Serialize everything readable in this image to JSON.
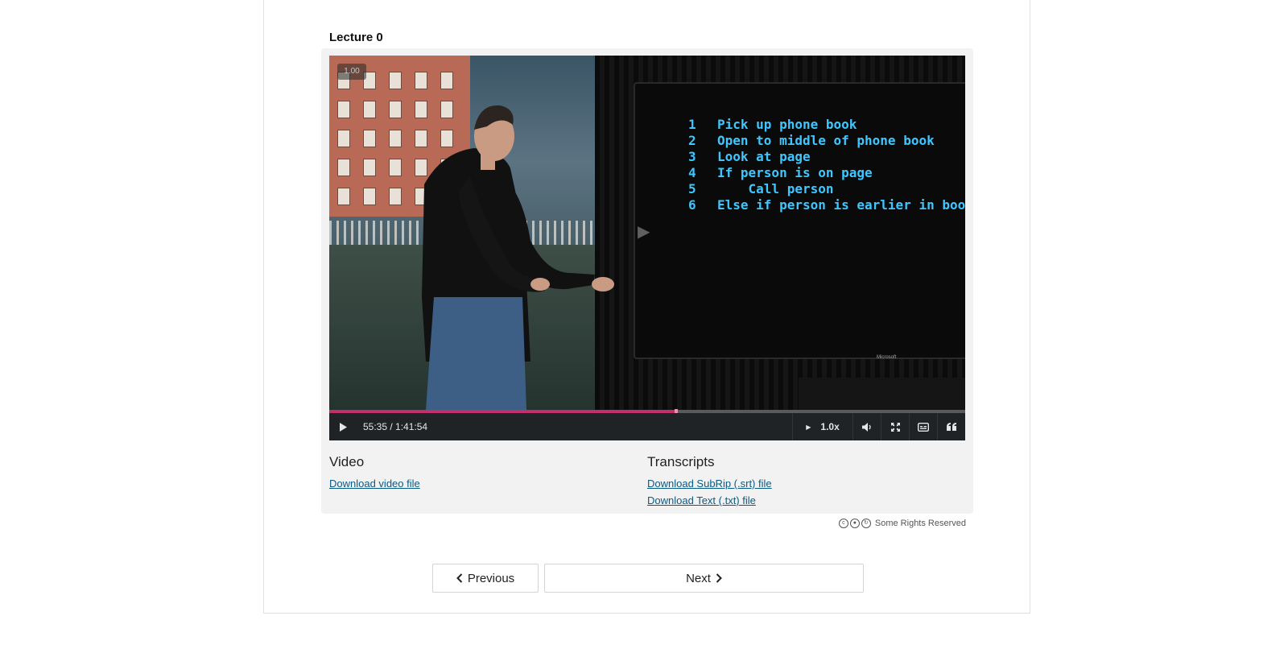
{
  "lecture": {
    "title": "Lecture 0"
  },
  "player": {
    "speed_badge": "1.00",
    "time_display": "55:35 / 1:41:54",
    "progress_fraction": 0.545,
    "speed_label": "1.0x",
    "accent_color": "#c0306b",
    "slide_code": [
      {
        "num": "1",
        "text": "Pick up phone book"
      },
      {
        "num": "2",
        "text": "Open to middle of phone book"
      },
      {
        "num": "3",
        "text": "Look at page"
      },
      {
        "num": "4",
        "text": "If person is on page"
      },
      {
        "num": "5",
        "text": "    Call person"
      },
      {
        "num": "6",
        "text": "Else if person is earlier in book"
      }
    ],
    "slide_brand": "Microsoft",
    "icons": [
      "play-icon",
      "speed-play-icon",
      "volume-icon",
      "fullscreen-icon",
      "captions-icon",
      "transcript-quote-icon"
    ]
  },
  "downloads": {
    "video": {
      "heading": "Video",
      "link": "Download video file"
    },
    "transcripts": {
      "heading": "Transcripts",
      "srt_link": "Download SubRip (.srt) file",
      "txt_link": "Download Text (.txt) file"
    }
  },
  "license": {
    "text": "Some Rights Reserved"
  },
  "nav": {
    "previous": "Previous",
    "next": "Next"
  }
}
